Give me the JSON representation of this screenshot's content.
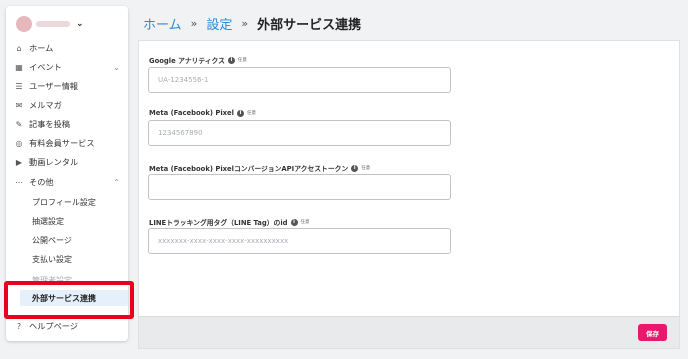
{
  "sidebar": {
    "items": [
      {
        "icon": "home-icon",
        "glyph": "⌂",
        "label": "ホーム"
      },
      {
        "icon": "calendar-icon",
        "glyph": "▦",
        "label": "イベント"
      },
      {
        "icon": "user-list-icon",
        "glyph": "☰",
        "label": "ユーザー情報"
      },
      {
        "icon": "mail-icon",
        "glyph": "✉",
        "label": "メルマガ"
      },
      {
        "icon": "post-icon",
        "glyph": "✎",
        "label": "記事を投稿"
      },
      {
        "icon": "paid-member-icon",
        "glyph": "◎",
        "label": "有料会員サービス"
      },
      {
        "icon": "video-icon",
        "glyph": "▶",
        "label": "動画レンタル"
      },
      {
        "icon": "more-icon",
        "glyph": "⋯",
        "label": "その他"
      }
    ],
    "sub_items": [
      "プロフィール設定",
      "抽選設定",
      "公開ページ",
      "支払い設定",
      "管理者設定",
      "外部サービス連携"
    ],
    "help": {
      "icon": "help-icon",
      "glyph": "?",
      "label": "ヘルプページ"
    }
  },
  "breadcrumb": {
    "home": "ホーム",
    "settings": "設定",
    "separator": "»",
    "current": "外部サービス連携"
  },
  "form": {
    "optional_badge": "任意",
    "fields": [
      {
        "label": "Google アナリティクス",
        "value": "",
        "placeholder": "UA-1234556-1"
      },
      {
        "label": "Meta (Facebook) Pixel",
        "value": "",
        "placeholder": "1234567890"
      },
      {
        "label": "Meta (Facebook) PixelコンバージョンAPIアクセストークン",
        "value": "",
        "placeholder": ""
      },
      {
        "label": "LINEトラッキング用タグ（LINE Tag）のid",
        "value": "",
        "placeholder": "xxxxxxx-xxxx-xxxx-xxxx-xxxxxxxxxx"
      }
    ],
    "save_label": "保存"
  },
  "colors": {
    "accent": "#2a8ad8",
    "save": "#e8196c",
    "highlight": "#e8001c",
    "active_bg": "#e6f0fb"
  }
}
